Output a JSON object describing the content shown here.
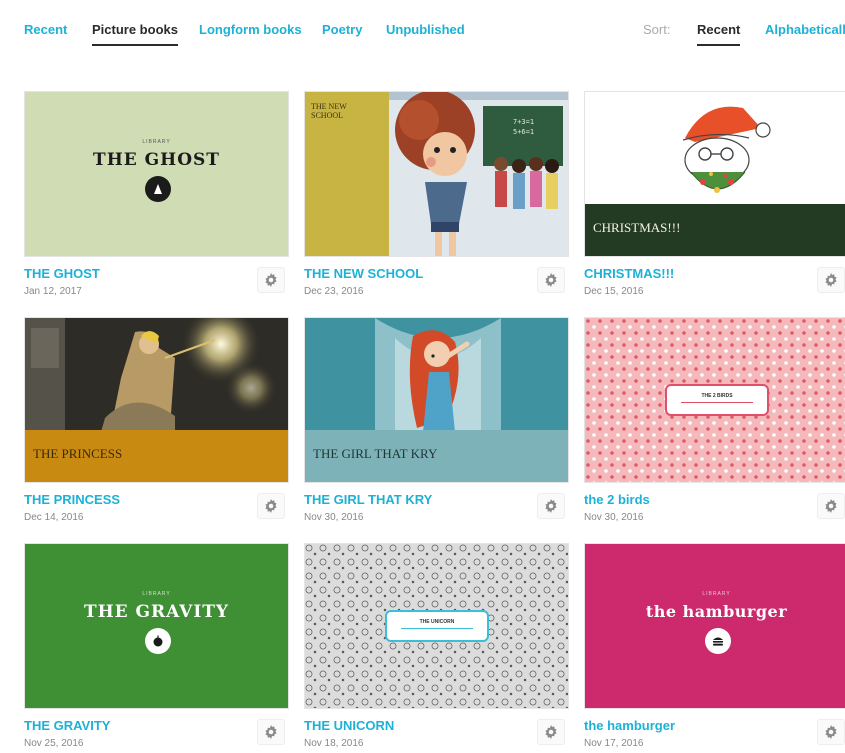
{
  "nav": {
    "tabs": [
      {
        "label": "Recent",
        "active": false
      },
      {
        "label": "Picture books",
        "active": true
      },
      {
        "label": "Longform books",
        "active": false
      },
      {
        "label": "Poetry",
        "active": false
      },
      {
        "label": "Unpublished",
        "active": false
      }
    ],
    "sort_label": "Sort:",
    "sort_options": [
      {
        "label": "Recent",
        "active": true
      },
      {
        "label": "Alphabetically",
        "active": false
      }
    ]
  },
  "colors": {
    "accent": "#1cb2d8",
    "active_text": "#2b2b2b"
  },
  "books": [
    {
      "title": "THE GHOST",
      "date": "Jan 12, 2017",
      "cover_title": "THE GHOST",
      "cover_style": "plain-title",
      "cover_color": "#cfdcb4",
      "icon": "ghost-icon"
    },
    {
      "title": "THE NEW SCHOOL",
      "date": "Dec 23, 2016",
      "cover_title": "THE NEW SCHOOL",
      "cover_style": "illustration",
      "cover_color": "#c8b442",
      "icon": "girl-illustration-icon"
    },
    {
      "title": "CHRISTMAS!!!",
      "date": "Dec 15, 2016",
      "cover_title": "CHRISTMAS!!!",
      "cover_style": "band",
      "cover_color": "#ffffff",
      "band_color": "#233a23",
      "icon": "santa-illustration-icon"
    },
    {
      "title": "THE PRINCESS",
      "date": "Dec 14, 2016",
      "cover_title": "THE PRINCESS",
      "cover_style": "band",
      "cover_color": "#3a3a34",
      "band_color": "#c98a12",
      "icon": "princess-illustration-icon"
    },
    {
      "title": "THE GIRL THAT KRY",
      "date": "Nov 30, 2016",
      "cover_title": "THE GIRL THAT KRY",
      "cover_style": "band",
      "cover_color": "#4a9da8",
      "band_color": "#7db3b8",
      "icon": "crying-girl-illustration-icon"
    },
    {
      "title": "the 2 birds",
      "date": "Nov 30, 2016",
      "cover_title": "THE 2 BIRDS",
      "cover_style": "label-pattern",
      "cover_color": "#f5b9bc",
      "label_color": "#e0506a",
      "icon": "bird-pattern-icon"
    },
    {
      "title": "THE GRAVITY",
      "date": "Nov 25, 2016",
      "cover_title": "THE GRAVITY",
      "cover_style": "plain-title",
      "cover_color": "#3f8f34",
      "icon": "apple-icon"
    },
    {
      "title": "THE UNICORN",
      "date": "Nov 18, 2016",
      "cover_title": "THE UNICORN",
      "cover_style": "label-pattern",
      "cover_color": "#d8d8d8",
      "label_color": "#3bbfd8",
      "icon": "doodle-pattern-icon"
    },
    {
      "title": "the hamburger",
      "date": "Nov 17, 2016",
      "cover_title": "the hamburger",
      "cover_style": "plain-title",
      "cover_color": "#cc2a6c",
      "icon": "hamburger-icon"
    }
  ]
}
